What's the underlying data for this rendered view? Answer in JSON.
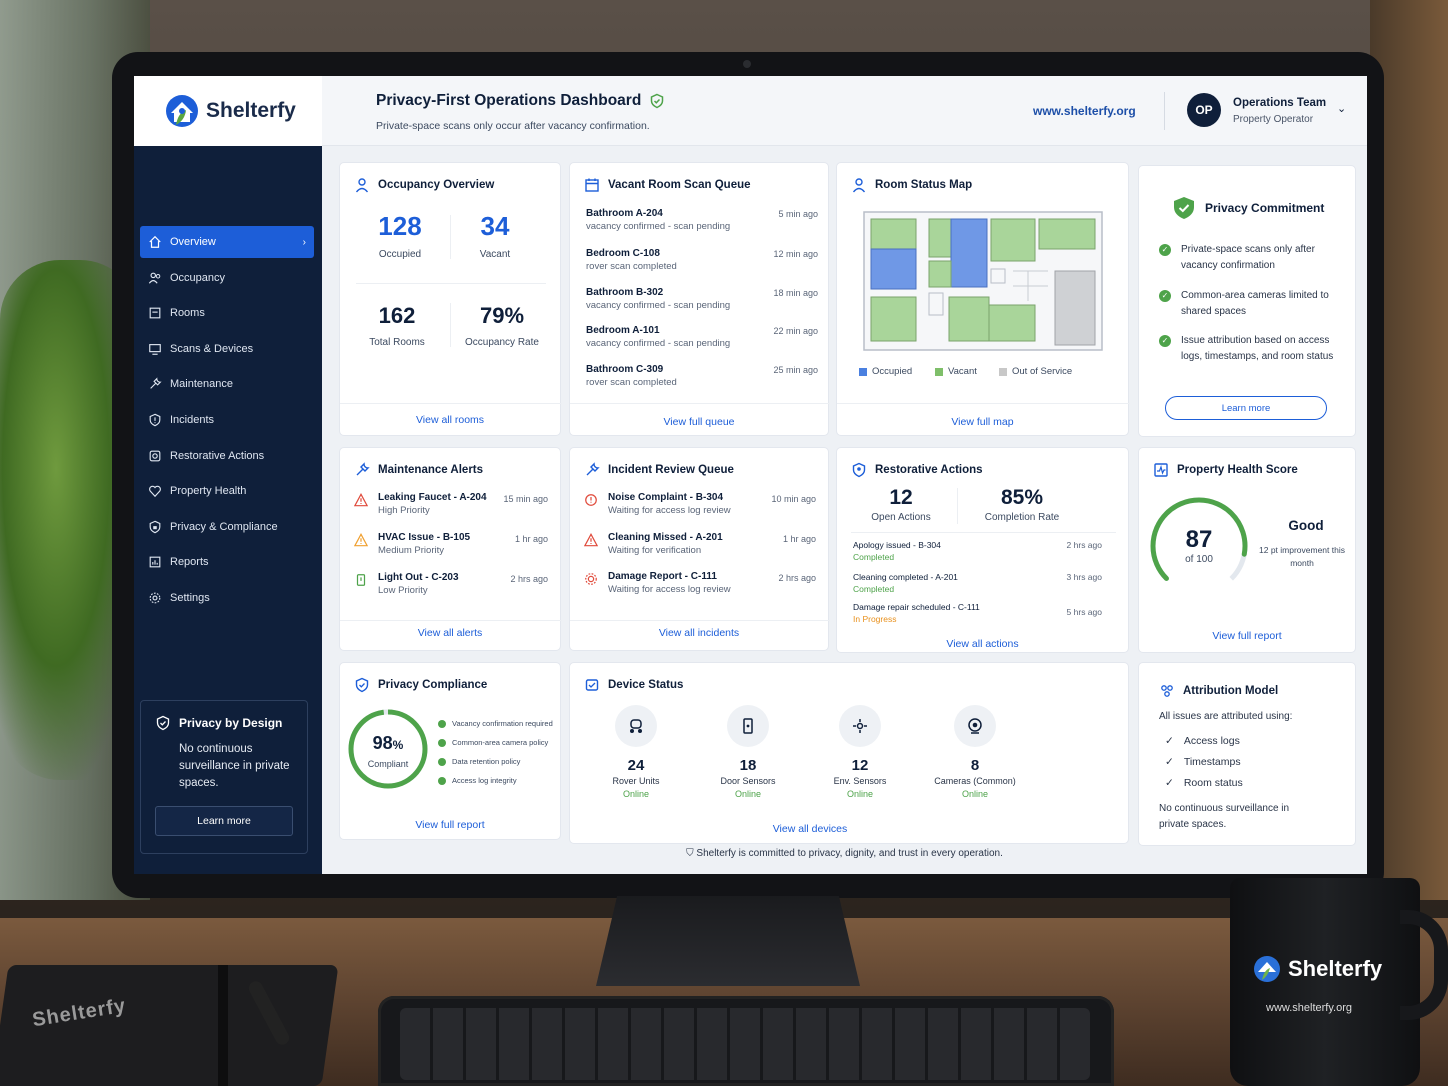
{
  "brand": {
    "name": "Shelterfy",
    "url": "www.shelterfy.org"
  },
  "header": {
    "title": "Privacy-First Operations Dashboard",
    "subtitle": "Private-space scans only occur after vacancy confirmation.",
    "url": "www.shelterfy.org",
    "avatar_initials": "OP",
    "team": "Operations Team",
    "role": "Property Operator"
  },
  "sidebar": {
    "items": [
      {
        "label": "Overview",
        "icon": "home-icon",
        "active": true
      },
      {
        "label": "Occupancy",
        "icon": "users-icon"
      },
      {
        "label": "Rooms",
        "icon": "door-icon"
      },
      {
        "label": "Scans & Devices",
        "icon": "scan-icon"
      },
      {
        "label": "Maintenance",
        "icon": "wrench-icon"
      },
      {
        "label": "Incidents",
        "icon": "alert-shield-icon"
      },
      {
        "label": "Restorative Actions",
        "icon": "restore-icon"
      },
      {
        "label": "Property Health",
        "icon": "heart-icon"
      },
      {
        "label": "Privacy & Compliance",
        "icon": "shield-icon"
      },
      {
        "label": "Reports",
        "icon": "chart-icon"
      },
      {
        "label": "Settings",
        "icon": "gear-icon"
      }
    ],
    "privacy_box": {
      "title": "Privacy by Design",
      "text": "No continuous surveillance in private spaces.",
      "button": "Learn more"
    }
  },
  "occupancy": {
    "title": "Occupancy Overview",
    "occupied": "128",
    "occupied_label": "Occupied",
    "vacant": "34",
    "vacant_label": "Vacant",
    "total": "162",
    "total_label": "Total Rooms",
    "rate": "79%",
    "rate_label": "Occupancy Rate",
    "link": "View all rooms"
  },
  "scan_queue": {
    "title": "Vacant Room Scan Queue",
    "rows": [
      {
        "room": "Bathroom A-204",
        "status": "vacancy confirmed - scan pending",
        "time": "5 min ago"
      },
      {
        "room": "Bedroom C-108",
        "status": "rover scan completed",
        "time": "12 min ago"
      },
      {
        "room": "Bathroom B-302",
        "status": "vacancy confirmed - scan pending",
        "time": "18 min ago"
      },
      {
        "room": "Bedroom A-101",
        "status": "vacancy confirmed - scan pending",
        "time": "22 min ago"
      },
      {
        "room": "Bathroom C-309",
        "status": "rover scan completed",
        "time": "25 min ago"
      }
    ],
    "link": "View full queue"
  },
  "room_map": {
    "title": "Room Status Map",
    "legend": [
      "Occupied",
      "Vacant",
      "Out of Service"
    ],
    "colors": {
      "occupied": "#4a80e0",
      "vacant": "#7fbf6a",
      "out_of_service": "#c8c8c8"
    },
    "link": "View full map"
  },
  "privacy_commitment": {
    "title": "Privacy Commitment",
    "items": [
      "Private-space scans only after vacancy confirmation",
      "Common-area cameras limited to shared spaces",
      "Issue attribution based on access logs, timestamps, and room status"
    ],
    "button": "Learn more"
  },
  "maintenance": {
    "title": "Maintenance Alerts",
    "rows": [
      {
        "title": "Leaking Faucet - A-204",
        "priority": "High Priority",
        "time": "15 min ago"
      },
      {
        "title": "HVAC Issue - B-105",
        "priority": "Medium Priority",
        "time": "1 hr ago"
      },
      {
        "title": "Light Out - C-203",
        "priority": "Low Priority",
        "time": "2 hrs ago"
      }
    ],
    "link": "View all alerts"
  },
  "incidents": {
    "title": "Incident Review Queue",
    "rows": [
      {
        "title": "Noise Complaint - B-304",
        "status": "Waiting for access log review",
        "time": "10 min ago"
      },
      {
        "title": "Cleaning Missed - A-201",
        "status": "Waiting for verification",
        "time": "1 hr ago"
      },
      {
        "title": "Damage Report - C-111",
        "status": "Waiting for access log review",
        "time": "2 hrs ago"
      }
    ],
    "link": "View all incidents"
  },
  "restorative": {
    "title": "Restorative Actions",
    "open": "12",
    "open_label": "Open Actions",
    "rate": "85%",
    "rate_label": "Completion Rate",
    "rows": [
      {
        "title": "Apology issued - B-304",
        "status": "Completed",
        "time": "2 hrs ago"
      },
      {
        "title": "Cleaning completed - A-201",
        "status": "Completed",
        "time": "3 hrs ago"
      },
      {
        "title": "Damage repair scheduled - C-111",
        "status": "In Progress",
        "time": "5 hrs ago"
      }
    ],
    "link": "View all actions"
  },
  "health": {
    "title": "Property Health Score",
    "score": "87",
    "of": "of 100",
    "score_value": 87,
    "rating": "Good",
    "note": "12 pt improvement this month",
    "link": "View full report"
  },
  "compliance": {
    "title": "Privacy Compliance",
    "pct": "98",
    "pct_sign": "%",
    "pct_value": 98,
    "label": "Compliant",
    "checks": [
      "Vacancy confirmation required",
      "Common-area camera policy",
      "Data retention policy",
      "Access log integrity"
    ],
    "link": "View full report"
  },
  "devices": {
    "title": "Device Status",
    "items": [
      {
        "count": "24",
        "label": "Rover Units",
        "status": "Online",
        "icon": "rover-icon"
      },
      {
        "count": "18",
        "label": "Door Sensors",
        "status": "Online",
        "icon": "door-sensor-icon"
      },
      {
        "count": "12",
        "label": "Env. Sensors",
        "status": "Online",
        "icon": "env-sensor-icon"
      },
      {
        "count": "8",
        "label": "Cameras (Common)",
        "status": "Online",
        "icon": "camera-icon"
      }
    ],
    "link": "View all devices"
  },
  "attribution": {
    "title": "Attribution Model",
    "intro": "All issues are attributed using:",
    "items": [
      "Access logs",
      "Timestamps",
      "Room status"
    ],
    "note": "No continuous surveillance in private spaces."
  },
  "footer": "Shelterfy is committed to privacy, dignity, and trust in every operation.",
  "props": {
    "notebook_brand": "Shelterfy",
    "mug_brand": "Shelterfy",
    "mug_url": "www.shelterfy.org"
  }
}
